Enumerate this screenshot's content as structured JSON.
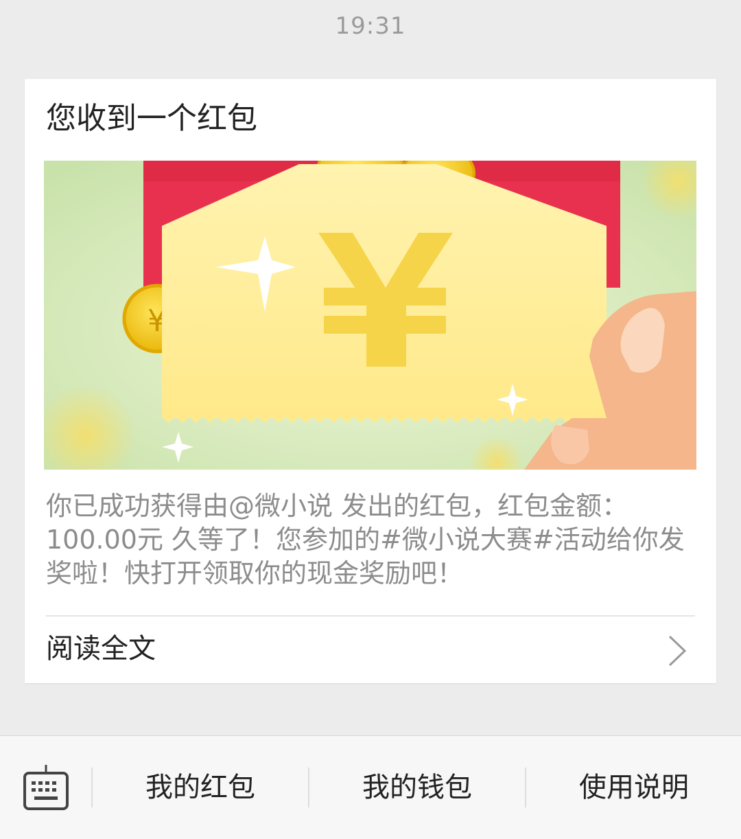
{
  "chat": {
    "timestamp": "19:31"
  },
  "card": {
    "title": "您收到一个红包",
    "banner": {
      "icon": "red-envelope-yuan-banner",
      "symbol": "¥"
    },
    "description": "你已成功获得由@微小说 发出的红包，红包金额：100.00元 久等了！您参加的#微小说大赛#活动给你发奖啦！快打开领取你的现金奖励吧！",
    "read_more_label": "阅读全文"
  },
  "menu": {
    "keyboard_icon": "keyboard-icon",
    "items": [
      {
        "label": "我的红包"
      },
      {
        "label": "我的钱包"
      },
      {
        "label": "使用说明"
      }
    ]
  },
  "colors": {
    "background": "#ececec",
    "card": "#ffffff",
    "envelope_red": "#e8314f",
    "coin_gold": "#f2c81c",
    "banner_green": "#cfe6b3"
  }
}
